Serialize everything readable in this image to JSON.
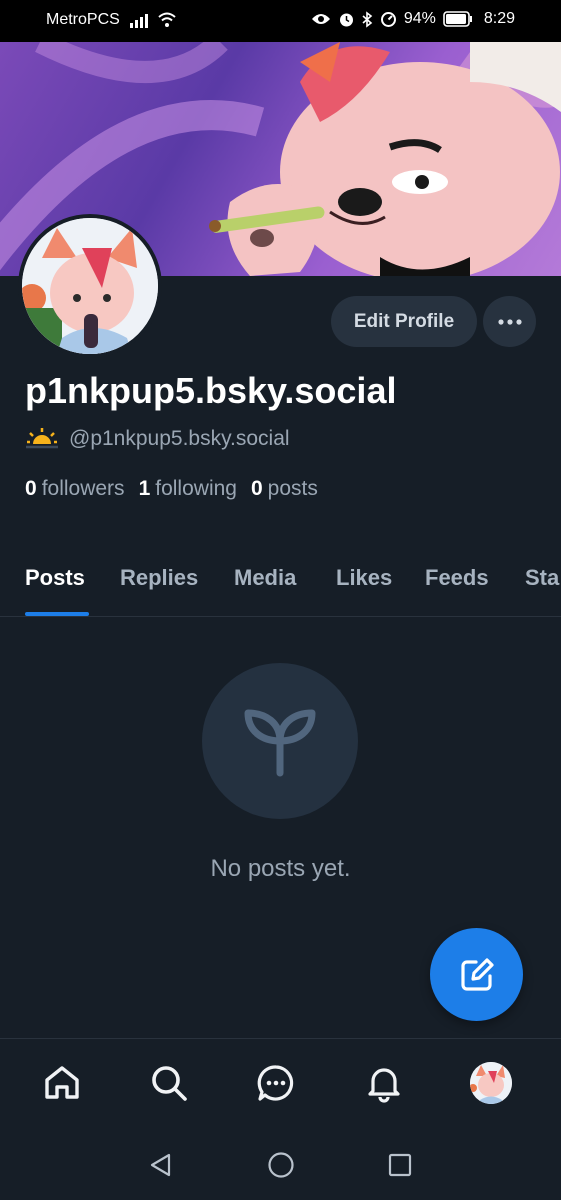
{
  "status_bar": {
    "carrier": "MetroPCS",
    "battery": "94%",
    "time": "8:29",
    "icons": [
      "signal-icon",
      "wifi-icon",
      "eye-icon",
      "alarm-icon",
      "bluetooth-icon",
      "data-saver-icon",
      "battery-icon"
    ]
  },
  "profile": {
    "display_name": "p1nkpup5.bsky.social",
    "handle": "@p1nkpup5.bsky.social",
    "handle_emoji": "sunrise-icon",
    "edit_label": "Edit Profile",
    "more_icon": "ellipsis-icon",
    "stats": {
      "followers_count": "0",
      "followers_label": "followers",
      "following_count": "1",
      "following_label": "following",
      "posts_count": "0",
      "posts_label": "posts"
    }
  },
  "tabs": [
    {
      "label": "Posts",
      "active": true
    },
    {
      "label": "Replies"
    },
    {
      "label": "Media"
    },
    {
      "label": "Likes"
    },
    {
      "label": "Feeds"
    },
    {
      "label": "Sta"
    }
  ],
  "empty_state": {
    "icon": "sprout-icon",
    "text": "No posts yet."
  },
  "fab": {
    "icon": "compose-icon"
  },
  "bottom_nav": [
    "home-icon",
    "search-icon",
    "chat-icon",
    "bell-icon",
    "profile-avatar"
  ],
  "system_nav": [
    "back-icon",
    "home-circle-icon",
    "recents-icon"
  ],
  "colors": {
    "background": "#161e27",
    "accent": "#1d7ee8",
    "muted_text": "#9aa6b3",
    "button_bg": "#27323f"
  }
}
